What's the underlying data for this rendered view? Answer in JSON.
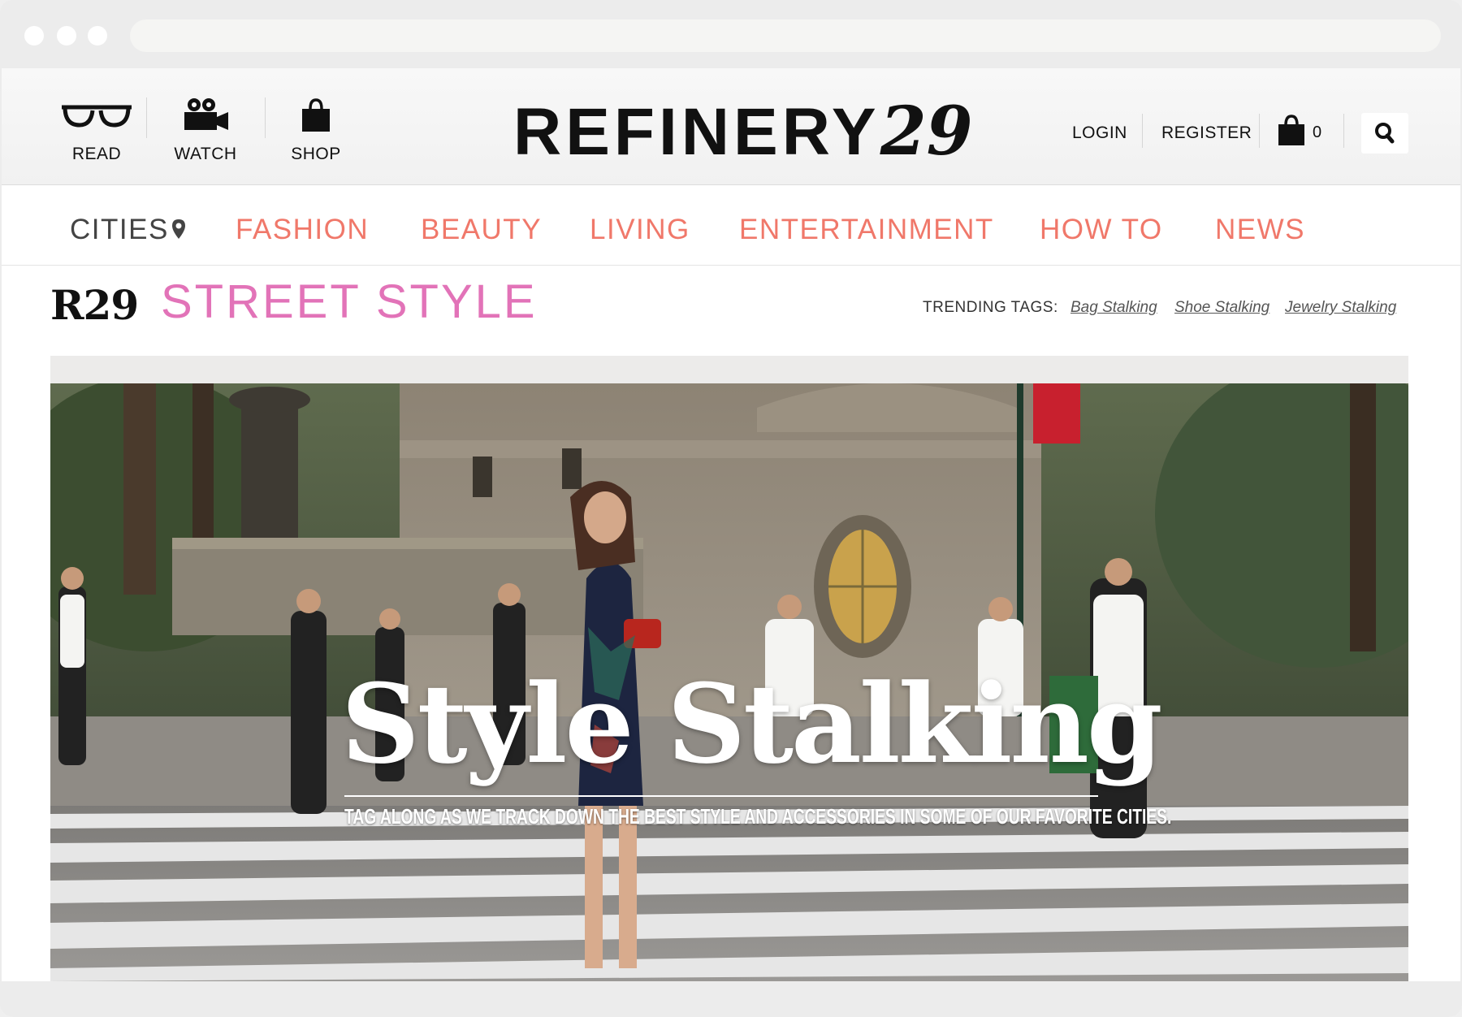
{
  "header": {
    "read_label": "READ",
    "watch_label": "WATCH",
    "shop_label": "SHOP",
    "logo_text": "REFINERY",
    "logo_number": "29",
    "login_label": "LOGIN",
    "register_label": "REGISTER",
    "cart_count": "0"
  },
  "nav": {
    "items": [
      {
        "label": "CITIES"
      },
      {
        "label": "FASHION"
      },
      {
        "label": "BEAUTY"
      },
      {
        "label": "LIVING"
      },
      {
        "label": "ENTERTAINMENT"
      },
      {
        "label": "HOW TO"
      },
      {
        "label": "NEWS"
      }
    ]
  },
  "section": {
    "logo": "R29",
    "title": "STREET STYLE",
    "trending_label": "TRENDING TAGS:",
    "tags": [
      "Bag Stalking",
      "Shoe Stalking",
      "Jewelry Stalking"
    ]
  },
  "hero": {
    "title": "Style Stalking",
    "subtitle": "TAG ALONG AS WE TRACK DOWN THE BEST STYLE AND ACCESSORIES IN SOME OF OUR FAVORITE CITIES."
  },
  "colors": {
    "nav_accent": "#f0786a",
    "street_style_pink": "#e273b8"
  }
}
